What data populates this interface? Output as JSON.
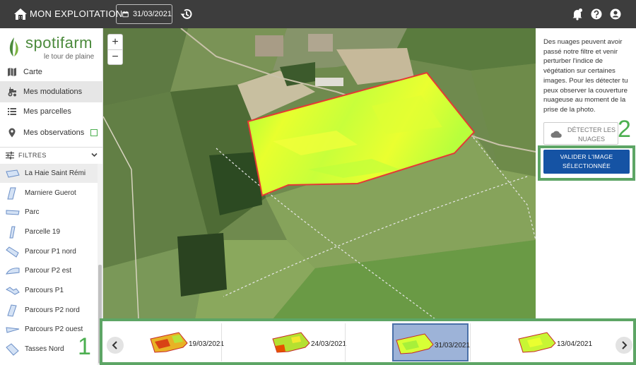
{
  "header": {
    "title": "MON EXPLOITATION",
    "date": "31/03/2021"
  },
  "logo": {
    "name": "spotifarm",
    "tagline": "le tour de plaine"
  },
  "nav": [
    {
      "label": "Carte",
      "icon": "map-icon"
    },
    {
      "label": "Mes modulations",
      "icon": "tractor-icon"
    },
    {
      "label": "Mes parcelles",
      "icon": "list-icon"
    },
    {
      "label": "Mes observations",
      "icon": "pin-icon"
    }
  ],
  "filters_label": "FILTRES",
  "parcels": [
    "La Haie Saint Rémi",
    "Marniere Guerot",
    "Parc",
    "Parcelle 19",
    "Parcour P1 nord",
    "Parcour P2 est",
    "Parcours P1",
    "Parcours P2 nord",
    "Parcours P2 ouest",
    "Tasses Nord"
  ],
  "annotation": {
    "marker_1": "1",
    "marker_2": "2"
  },
  "panel": {
    "text": "Des nuages peuvent avoir passé notre filtre et venir perturber l'indice de végétation sur certaines images. Pour les détecter tu peux observer la couverture nuageuse au moment de la prise de la photo.",
    "detect_line1": "DÉTECTER LES",
    "detect_line2": "NUAGES",
    "validate_line1": "VALIDER L'IMAGE",
    "validate_line2": "SÉLECTIONNÉE"
  },
  "timeline": [
    {
      "date": "19/03/2021",
      "active": false
    },
    {
      "date": "24/03/2021",
      "active": false
    },
    {
      "date": "31/03/2021",
      "active": true
    },
    {
      "date": "13/04/2021",
      "active": false
    }
  ],
  "colors": {
    "topbar": "#3d3d3d",
    "brand_green": "#4b8a3c",
    "annotation_green": "#5da565",
    "primary_blue": "#1553a4",
    "field_outline": "#e53935"
  }
}
